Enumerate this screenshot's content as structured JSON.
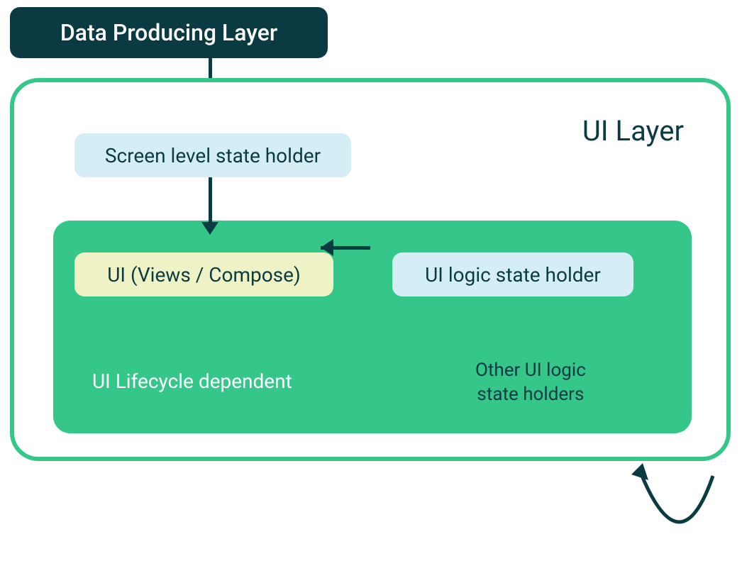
{
  "dataLayer": {
    "title": "Data Producing Layer"
  },
  "uiLayer": {
    "title": "UI Layer",
    "screenHolder": "Screen level state holder",
    "lifecycle": {
      "uiViews": "UI (Views / Compose)",
      "uiLogicHolder": "UI logic state holder",
      "title": "UI Lifecycle dependent",
      "otherHolders": "Other UI logic\nstate holders"
    }
  },
  "arrows": {
    "dataToScreen": "down",
    "screenToUi": "down",
    "logicToUi": "left",
    "selfLoop": "curve"
  }
}
